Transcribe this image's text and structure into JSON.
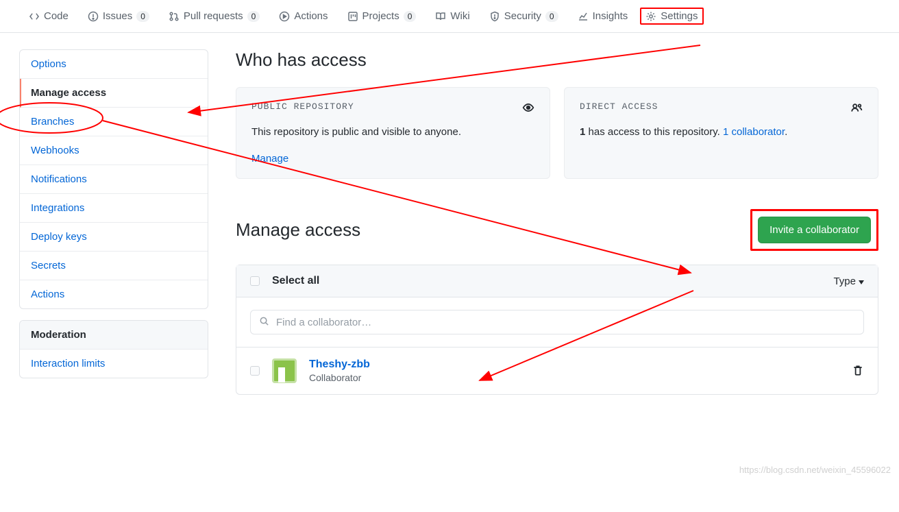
{
  "nav": {
    "code": "Code",
    "issues": "Issues",
    "issues_count": "0",
    "pulls": "Pull requests",
    "pulls_count": "0",
    "actions": "Actions",
    "projects": "Projects",
    "projects_count": "0",
    "wiki": "Wiki",
    "security": "Security",
    "security_count": "0",
    "insights": "Insights",
    "settings": "Settings"
  },
  "sidebar": {
    "options": "Options",
    "manage_access": "Manage access",
    "branches": "Branches",
    "webhooks": "Webhooks",
    "notifications": "Notifications",
    "integrations": "Integrations",
    "deploy_keys": "Deploy keys",
    "secrets": "Secrets",
    "actions": "Actions",
    "moderation_header": "Moderation",
    "interaction_limits": "Interaction limits"
  },
  "content": {
    "who_has_access": "Who has access",
    "public_repo_label": "PUBLIC REPOSITORY",
    "public_repo_text": "This repository is public and visible to anyone.",
    "manage_link": "Manage",
    "direct_access_label": "DIRECT ACCESS",
    "direct_access_count": "1",
    "direct_access_text1": " has access to this repository. ",
    "direct_access_link_count": "1",
    "direct_access_link_text": "collaborator",
    "direct_access_period": ".",
    "manage_access_title": "Manage access",
    "invite_btn": "Invite a collaborator",
    "select_all": "Select all",
    "type_dd": "Type",
    "search_placeholder": "Find a collaborator…",
    "collab_name": "Theshy-zbb",
    "collab_role": "Collaborator"
  },
  "watermark": "https://blog.csdn.net/weixin_45596022"
}
